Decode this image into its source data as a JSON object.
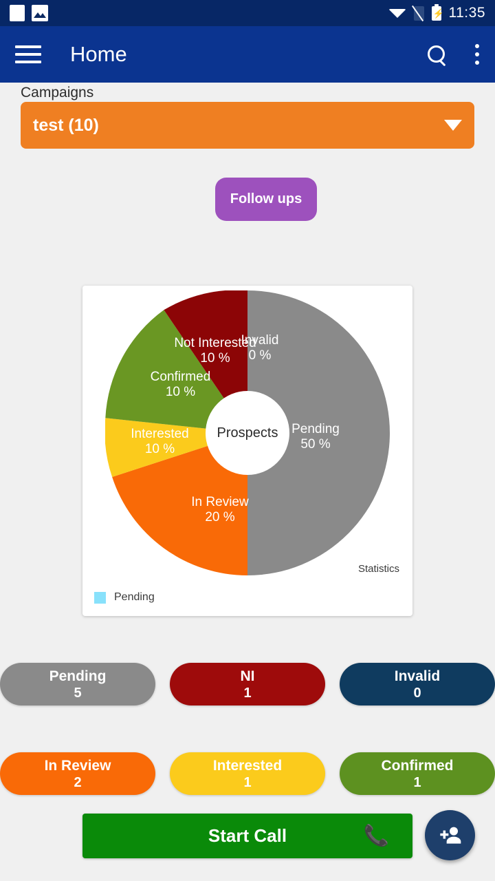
{
  "status_bar": {
    "time": "11:35",
    "icons": [
      "notification-square-icon",
      "notification-image-icon",
      "wifi-icon",
      "sim-off-icon",
      "battery-charging-icon"
    ]
  },
  "app_bar": {
    "menu_icon": "hamburger-icon",
    "title": "Home",
    "search_icon": "search-icon",
    "overflow_icon": "kebab-menu-icon"
  },
  "campaigns": {
    "label": "Campaigns",
    "selected": "test (10)",
    "caret_icon": "chevron-down-icon",
    "color": "#ef7f22"
  },
  "follow_ups": {
    "label": "Follow ups",
    "color": "#9d51bd"
  },
  "chart_data": {
    "type": "pie",
    "title": "Prospects",
    "caption": "Statistics",
    "center_label": "Prospects",
    "percent_suffix": "%",
    "legend": {
      "position": "bottom-left",
      "entries": [
        {
          "label": "Pending",
          "color": "#88e1fb"
        }
      ]
    },
    "slices": [
      {
        "label": "Pending",
        "value": 50,
        "display": "50  %",
        "color": "#8a8a8a",
        "start_angle": 0,
        "end_angle": 180
      },
      {
        "label": "In Review",
        "value": 20,
        "display": "20  %",
        "color": "#f96a07",
        "start_angle": 180,
        "end_angle": 252
      },
      {
        "label": "Interested",
        "value": 10,
        "display": "10  %",
        "color": "#fbcb1c",
        "start_angle": 252,
        "end_angle": 288
      },
      {
        "label": "Confirmed",
        "value": 10,
        "display": "10  %",
        "color": "#6a9723",
        "start_angle": 288,
        "end_angle": 324
      },
      {
        "label": "Not Interested",
        "value": 10,
        "display": "10  %",
        "color": "#8c0506",
        "start_angle": 324,
        "end_angle": 360
      },
      {
        "label": "Invalid",
        "value": 0,
        "display": "0  %",
        "color": "#8c0506",
        "start_angle": 360,
        "end_angle": 360
      }
    ],
    "labels": [
      {
        "name": "Pending",
        "percent": "50  %"
      },
      {
        "name": "In Review",
        "percent": "20  %"
      },
      {
        "name": "Interested",
        "percent": "10  %"
      },
      {
        "name": "Confirmed",
        "percent": "10  %"
      },
      {
        "name": "Not Interested",
        "percent": "10  %"
      },
      {
        "name": "Invalid",
        "percent": "0  %"
      }
    ]
  },
  "stat_pills": {
    "row1": [
      {
        "name": "Pending",
        "count": "5",
        "color": "#8a8a8a"
      },
      {
        "name": "NI",
        "count": "1",
        "color": "#9e0b0b"
      },
      {
        "name": "Invalid",
        "count": "0",
        "color": "#0f3b5f"
      }
    ],
    "row2": [
      {
        "name": "In Review",
        "count": "2",
        "color": "#f96a07"
      },
      {
        "name": "Interested",
        "count": "1",
        "color": "#fbcb1c"
      },
      {
        "name": "Confirmed",
        "count": "1",
        "color": "#5d9120"
      }
    ]
  },
  "bottom": {
    "start_call_label": "Start Call",
    "start_call_color": "#0a8a09",
    "phone_icon": "phone-call-icon",
    "fab_icon": "person-add-icon",
    "fab_color": "#1e3f6b"
  }
}
